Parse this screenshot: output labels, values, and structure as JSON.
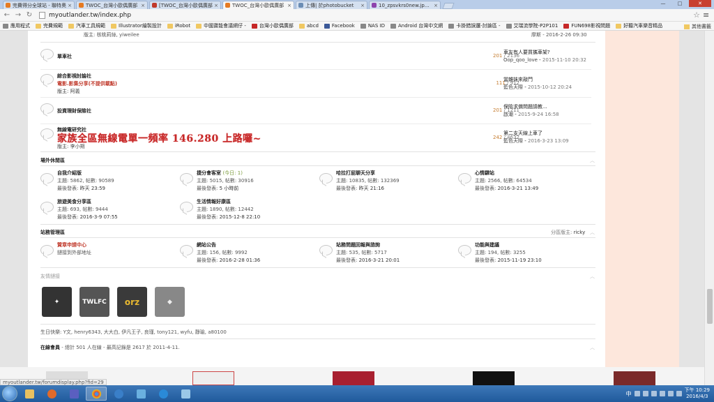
{
  "browser": {
    "tabs": [
      {
        "label": "完費得分全球站 - 聯特奧",
        "icon": "orange"
      },
      {
        "label": "TWOC_台灣小歐偶廣部",
        "icon": "orange"
      },
      {
        "label": "[TWOC_台灣小歐偶廣部",
        "icon": "gmail"
      },
      {
        "label": "TWOC_台灣小歐偶廣部",
        "icon": "orange",
        "active": true
      },
      {
        "label": "上傳| 於photobucket",
        "icon": "grey"
      },
      {
        "label": "10_zpsvkrs0new.jpg Pho",
        "icon": "grey"
      }
    ],
    "url": "myoutlander.tw/index.php",
    "bookmarks": [
      "應用程式",
      "完費規範",
      "汽車工具規範",
      "Illustrator繪製設計",
      "iRobot",
      "中國寶能會議網仔 -",
      "台灣小歐偶廣部",
      "abcd",
      "Facebook",
      "NAS ID",
      "Android 台灣中文網",
      "卡掛錯誤邏-討論區 -",
      "艾瑞流學院-P2P101",
      "FUN698影視問題",
      "好聽汽車樂音精品"
    ],
    "bookmarks_other": "其他書籤",
    "status_url": "myoutlander.tw/forumdisplay.php?fid=29"
  },
  "top_partial": {
    "mod": "版主: 核桃莉絲, yiweilee",
    "last": "摩斯 - 2016-2-26 09:30"
  },
  "forums": [
    {
      "name": "單車社",
      "stats_a": "201",
      "stats_b": "2136",
      "last_title": "車友有人要買攜車架?",
      "last_who": "Oop_qoo_love",
      "last_when": "2015-11-10 20:32"
    },
    {
      "name": "綜合影視討論社",
      "sub": "電影.影集分享(不提供載點)",
      "mod": "版主: 阿義",
      "stats_a": "111",
      "stats_b": "912",
      "last_title": "當雜妹來敲門",
      "last_who": "藍色天際",
      "last_when": "2015-10-12 20:24"
    },
    {
      "name": "投資理財保險社",
      "stats_a": "201",
      "stats_b": "1211",
      "last_title": "保險求償問題請教...",
      "last_who": "啟潮",
      "last_when": "2015-9-24 16:58"
    },
    {
      "name": "無線電研究社",
      "banner": "家族全區無線電單一頻率 146.280 上路囉~",
      "mod": "版主: 李小朔",
      "stats_a": "242",
      "stats_b": "4632",
      "last_title": "第二支天線上車了",
      "last_who": "藍色天際",
      "last_when": "2016-3-23 13:09"
    }
  ],
  "section_leisure": {
    "title": "場外休閒區",
    "cells": [
      {
        "name": "自我介紹版",
        "stat": "主題: 5862, 帖數: 90589",
        "post_label": "最後發表:",
        "post": "昨天 23:59"
      },
      {
        "name": "捷分會客室",
        "extra": "(今日: 1)",
        "stat": "主題: 5015, 帖數: 30916",
        "post_label": "最後發表:",
        "post": "5 小時前"
      },
      {
        "name": "哈拉打屁聊天分享",
        "stat": "主題: 10835, 帖數: 132369",
        "post_label": "最後發表:",
        "post": "昨天 21:16"
      },
      {
        "name": "心情驛站",
        "stat": "主題: 2566, 帖數: 64534",
        "post_label": "最後發表:",
        "post": "2016-3-21 13:49"
      },
      {
        "name": "旅遊美食分享區",
        "stat": "主題: 693, 帖數: 9444",
        "post_label": "最後發表:",
        "post": "2016-3-9 07:55"
      },
      {
        "name": "生活情報好康區",
        "stat": "主題: 1890, 帖數: 12442",
        "post_label": "最後發表:",
        "post": "2015-12-8 22:10"
      }
    ]
  },
  "section_admin": {
    "title": "站務管理區",
    "moderator_label": "分區版主:",
    "moderator": "ricky",
    "cells": [
      {
        "name": "贊章申請中心",
        "red": true,
        "stat": "鏈接到外部地址",
        "post_label": "",
        "post": ""
      },
      {
        "name": "網站公告",
        "stat": "主題: 156, 帖數: 9992",
        "post_label": "最後發表:",
        "post": "2016-2-28 01:36"
      },
      {
        "name": "站務問題回報與諮詢",
        "stat": "主題: 535, 帖數: 5717",
        "post_label": "最後發表:",
        "post": "2016-3-21 20:01"
      },
      {
        "name": "功能與建議",
        "stat": "主題: 194, 帖數: 3255",
        "post_label": "最後發表:",
        "post": "2015-11-19 23:10"
      }
    ]
  },
  "friend_links": {
    "title": "友情鏈接",
    "logos": [
      "logo-1",
      "TWLFC",
      "orz",
      "logo-4"
    ]
  },
  "birthday": "生日快樂: Y文, henry6343, 大大白, 伊凡王子, 良瑾, tony121, wyfu, 靜瑜, a80100",
  "online": {
    "label": "在線會員",
    "text": "- 總計 501 人在線 - 最高記錄是 2617 於 2011-4-11."
  },
  "taskbar": {
    "lang": "中",
    "time": "下午 10:29",
    "date": "2016/4/3"
  }
}
